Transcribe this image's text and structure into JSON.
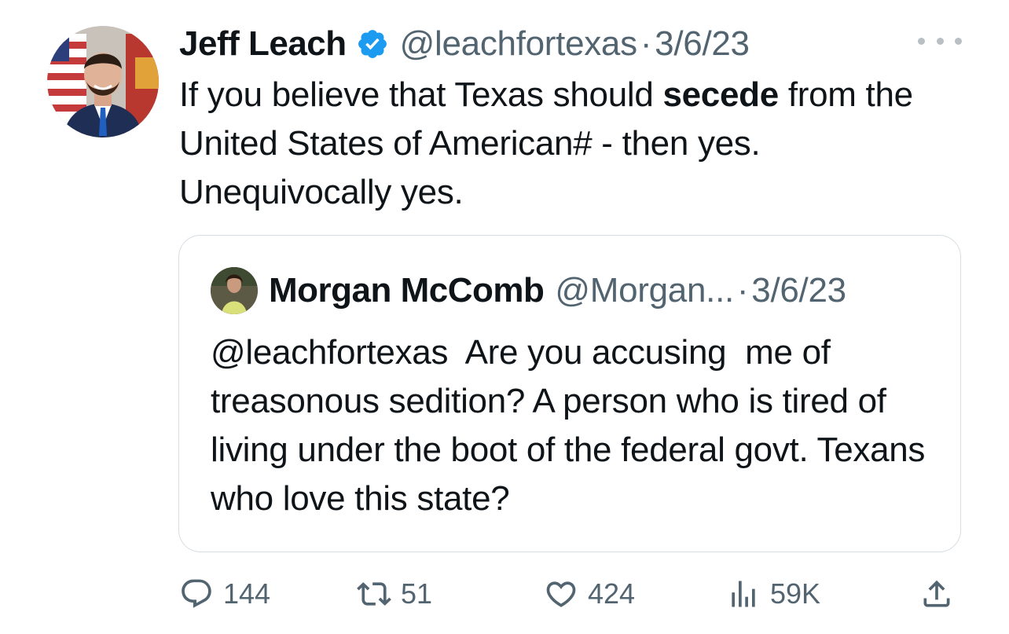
{
  "tweet": {
    "author_name": "Jeff Leach",
    "handle": "@leachfortexas",
    "separator": "·",
    "date": "3/6/23",
    "text_before": "If you believe that Texas should ",
    "text_bold": "secede",
    "text_after": " from the United States of American# - then yes. Unequivocally yes."
  },
  "quote": {
    "author_name": "Morgan McComb",
    "handle": "@Morgan...",
    "separator": "·",
    "date": "3/6/23",
    "text": "@leachfortexas  Are you accusing  me of treasonous sedition? A person who is tired of living under the boot of the federal govt. Texans who love this state?"
  },
  "actions": {
    "replies": "144",
    "retweets": "51",
    "likes": "424",
    "views": "59K"
  },
  "icons": {
    "verified": "verified-badge-icon",
    "more": "more-options-icon",
    "reply": "reply-icon",
    "retweet": "retweet-icon",
    "like": "heart-icon",
    "views": "views-chart-icon",
    "share": "share-icon"
  },
  "colors": {
    "verified_blue": "#1d9bf0",
    "secondary_text": "#536471",
    "primary_text": "#0f1419",
    "border": "#d6dde3"
  }
}
